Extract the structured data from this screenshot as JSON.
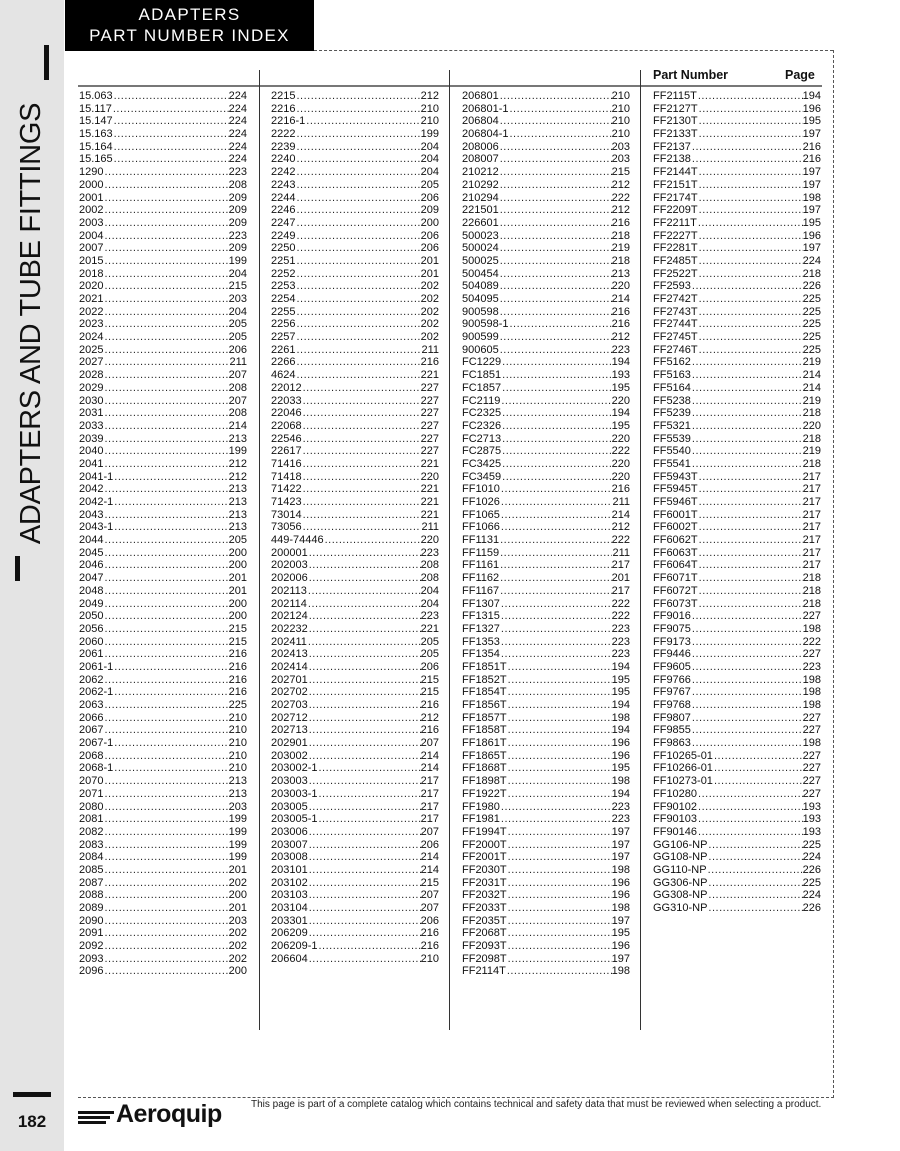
{
  "header": {
    "title_line1": "ADAPTERS",
    "title_line2": "PART NUMBER INDEX"
  },
  "sidebar": {
    "section_label": "ADAPTERS AND TUBE FITTINGS",
    "page_number": "182"
  },
  "table": {
    "header_part_number": "Part Number",
    "header_page": "Page",
    "columns": [
      [
        [
          "15.063",
          "224"
        ],
        [
          "15.117",
          "224"
        ],
        [
          "15.147",
          "224"
        ],
        [
          "15.163",
          "224"
        ],
        [
          "15.164",
          "224"
        ],
        [
          "15.165",
          "224"
        ],
        [
          "1290",
          "223"
        ],
        [
          "2000",
          "208"
        ],
        [
          "2001",
          "209"
        ],
        [
          "2002",
          "209"
        ],
        [
          "2003",
          "209"
        ],
        [
          "2004",
          "223"
        ],
        [
          "2007",
          "209"
        ],
        [
          "2015",
          "199"
        ],
        [
          "2018",
          "204"
        ],
        [
          "2020",
          "215"
        ],
        [
          "2021",
          "203"
        ],
        [
          "2022",
          "204"
        ],
        [
          "2023",
          "205"
        ],
        [
          "2024",
          "205"
        ],
        [
          "2025",
          "206"
        ],
        [
          "2027",
          "211"
        ],
        [
          "2028",
          "207"
        ],
        [
          "2029",
          "208"
        ],
        [
          "2030",
          "207"
        ],
        [
          "2031",
          "208"
        ],
        [
          "2033",
          "214"
        ],
        [
          "2039",
          "213"
        ],
        [
          "2040",
          "199"
        ],
        [
          "2041",
          "212"
        ],
        [
          "2041-1",
          "212"
        ],
        [
          "2042",
          "213"
        ],
        [
          "2042-1",
          "213"
        ],
        [
          "2043",
          "213"
        ],
        [
          "2043-1",
          "213"
        ],
        [
          "2044",
          "205"
        ],
        [
          "2045",
          "200"
        ],
        [
          "2046",
          "200"
        ],
        [
          "2047",
          "201"
        ],
        [
          "2048",
          "201"
        ],
        [
          "2049",
          "200"
        ],
        [
          "2050",
          "200"
        ],
        [
          "2056",
          "215"
        ],
        [
          "2060",
          "215"
        ],
        [
          "2061",
          "216"
        ],
        [
          "2061-1",
          "216"
        ],
        [
          "2062",
          "216"
        ],
        [
          "2062-1",
          "216"
        ],
        [
          "2063",
          "225"
        ],
        [
          "2066",
          "210"
        ],
        [
          "2067",
          "210"
        ],
        [
          "2067-1",
          "210"
        ],
        [
          "2068",
          "210"
        ],
        [
          "2068-1",
          "210"
        ],
        [
          "2070",
          "213"
        ],
        [
          "2071",
          "213"
        ],
        [
          "2080",
          "203"
        ],
        [
          "2081",
          "199"
        ],
        [
          "2082",
          "199"
        ],
        [
          "2083",
          "199"
        ],
        [
          "2084",
          "199"
        ],
        [
          "2085",
          "201"
        ],
        [
          "2087",
          "202"
        ],
        [
          "2088",
          "200"
        ],
        [
          "2089",
          "201"
        ],
        [
          "2090",
          "203"
        ],
        [
          "2091",
          "202"
        ],
        [
          "2092",
          "202"
        ],
        [
          "2093",
          "202"
        ],
        [
          "2096",
          "200"
        ]
      ],
      [
        [
          "2215",
          "212"
        ],
        [
          "2216",
          "210"
        ],
        [
          "2216-1",
          "210"
        ],
        [
          "2222",
          "199"
        ],
        [
          "2239",
          "204"
        ],
        [
          "2240",
          "204"
        ],
        [
          "2242",
          "204"
        ],
        [
          "2243",
          "205"
        ],
        [
          "2244",
          "206"
        ],
        [
          "2246",
          "209"
        ],
        [
          "2247",
          "200"
        ],
        [
          "2249",
          "206"
        ],
        [
          "2250",
          "206"
        ],
        [
          "2251",
          "201"
        ],
        [
          "2252",
          "201"
        ],
        [
          "2253",
          "202"
        ],
        [
          "2254",
          "202"
        ],
        [
          "2255",
          "202"
        ],
        [
          "2256",
          "202"
        ],
        [
          "2257",
          "202"
        ],
        [
          "2261",
          "211"
        ],
        [
          "2266",
          "216"
        ],
        [
          "4624",
          "221"
        ],
        [
          "22012",
          "227"
        ],
        [
          "22033",
          "227"
        ],
        [
          "22046",
          "227"
        ],
        [
          "22068",
          "227"
        ],
        [
          "22546",
          "227"
        ],
        [
          "22617",
          "227"
        ],
        [
          "71416",
          "221"
        ],
        [
          "71418",
          "220"
        ],
        [
          "71422",
          "221"
        ],
        [
          "71423",
          "221"
        ],
        [
          "73014",
          "221"
        ],
        [
          "73056",
          "211"
        ],
        [
          "449-74446",
          "220"
        ],
        [
          "200001",
          "223"
        ],
        [
          "202003",
          "208"
        ],
        [
          "202006",
          "208"
        ],
        [
          "202113",
          "204"
        ],
        [
          "202114",
          "204"
        ],
        [
          "202124",
          "223"
        ],
        [
          "202232",
          "221"
        ],
        [
          "202411",
          "205"
        ],
        [
          "202413",
          "205"
        ],
        [
          "202414",
          "206"
        ],
        [
          "202701",
          "215"
        ],
        [
          "202702",
          "215"
        ],
        [
          "202703",
          "216"
        ],
        [
          "202712",
          "212"
        ],
        [
          "202713",
          "216"
        ],
        [
          "202901",
          "207"
        ],
        [
          "203002",
          "214"
        ],
        [
          "203002-1",
          "214"
        ],
        [
          "203003",
          "217"
        ],
        [
          "203003-1",
          "217"
        ],
        [
          "203005",
          "217"
        ],
        [
          "203005-1",
          "217"
        ],
        [
          "203006",
          "207"
        ],
        [
          "203007",
          "206"
        ],
        [
          "203008",
          "214"
        ],
        [
          "203101",
          "214"
        ],
        [
          "203102",
          "215"
        ],
        [
          "203103",
          "207"
        ],
        [
          "203104",
          "207"
        ],
        [
          "203301",
          "206"
        ],
        [
          "206209",
          "216"
        ],
        [
          "206209-1",
          "216"
        ],
        [
          "206604",
          "210"
        ]
      ],
      [
        [
          "206801",
          "210"
        ],
        [
          "206801-1",
          "210"
        ],
        [
          "206804",
          "210"
        ],
        [
          "206804-1",
          "210"
        ],
        [
          "208006",
          "203"
        ],
        [
          "208007",
          "203"
        ],
        [
          "210212",
          "215"
        ],
        [
          "210292",
          "212"
        ],
        [
          "210294",
          "222"
        ],
        [
          "221501",
          "212"
        ],
        [
          "226601",
          "216"
        ],
        [
          "500023",
          "218"
        ],
        [
          "500024",
          "219"
        ],
        [
          "500025",
          "218"
        ],
        [
          "500454",
          "213"
        ],
        [
          "504089",
          "220"
        ],
        [
          "504095",
          "214"
        ],
        [
          "900598",
          "216"
        ],
        [
          "900598-1",
          "216"
        ],
        [
          "900599",
          "212"
        ],
        [
          "900605",
          "223"
        ],
        [
          "FC1229",
          "194"
        ],
        [
          "FC1851",
          "193"
        ],
        [
          "FC1857",
          "195"
        ],
        [
          "FC2119",
          "220"
        ],
        [
          "FC2325",
          "194"
        ],
        [
          "FC2326",
          "195"
        ],
        [
          "FC2713",
          "220"
        ],
        [
          "FC2875",
          "222"
        ],
        [
          "FC3425",
          "220"
        ],
        [
          "FC3459",
          "220"
        ],
        [
          "FF1010",
          "216"
        ],
        [
          "FF1026",
          "211"
        ],
        [
          "FF1065",
          "214"
        ],
        [
          "FF1066",
          "212"
        ],
        [
          "FF1131",
          "222"
        ],
        [
          "FF1159",
          "211"
        ],
        [
          "FF1161",
          "217"
        ],
        [
          "FF1162",
          "201"
        ],
        [
          "FF1167",
          "217"
        ],
        [
          "FF1307",
          "222"
        ],
        [
          "FF1315",
          "222"
        ],
        [
          "FF1327",
          "223"
        ],
        [
          "FF1353",
          "223"
        ],
        [
          "FF1354",
          "223"
        ],
        [
          "FF1851T",
          "194"
        ],
        [
          "FF1852T",
          "195"
        ],
        [
          "FF1854T",
          "195"
        ],
        [
          "FF1856T",
          "194"
        ],
        [
          "FF1857T",
          "198"
        ],
        [
          "FF1858T",
          "194"
        ],
        [
          "FF1861T",
          "196"
        ],
        [
          "FF1865T",
          "196"
        ],
        [
          "FF1868T",
          "195"
        ],
        [
          "FF1898T",
          "198"
        ],
        [
          "FF1922T",
          "194"
        ],
        [
          "FF1980",
          "223"
        ],
        [
          "FF1981",
          "223"
        ],
        [
          "FF1994T",
          "197"
        ],
        [
          "FF2000T",
          "197"
        ],
        [
          "FF2001T",
          "197"
        ],
        [
          "FF2030T",
          "198"
        ],
        [
          "FF2031T",
          "196"
        ],
        [
          "FF2032T",
          "196"
        ],
        [
          "FF2033T",
          "198"
        ],
        [
          "FF2035T",
          "197"
        ],
        [
          "FF2068T",
          "195"
        ],
        [
          "FF2093T",
          "196"
        ],
        [
          "FF2098T",
          "197"
        ],
        [
          "FF2114T",
          "198"
        ]
      ],
      [
        [
          "FF2115T",
          "194"
        ],
        [
          "FF2127T",
          "196"
        ],
        [
          "FF2130T",
          "195"
        ],
        [
          "FF2133T",
          "197"
        ],
        [
          "FF2137",
          "216"
        ],
        [
          "FF2138",
          "216"
        ],
        [
          "FF2144T",
          "197"
        ],
        [
          "FF2151T",
          "197"
        ],
        [
          "FF2174T",
          "198"
        ],
        [
          "FF2209T",
          "197"
        ],
        [
          "FF2211T",
          "195"
        ],
        [
          "FF2227T",
          "196"
        ],
        [
          "FF2281T",
          "197"
        ],
        [
          "FF2485T",
          "224"
        ],
        [
          "FF2522T",
          "218"
        ],
        [
          "FF2593",
          "226"
        ],
        [
          "FF2742T",
          "225"
        ],
        [
          "FF2743T",
          "225"
        ],
        [
          "FF2744T",
          "225"
        ],
        [
          "FF2745T",
          "225"
        ],
        [
          "FF2746T",
          "225"
        ],
        [
          "FF5162",
          "219"
        ],
        [
          "FF5163",
          "214"
        ],
        [
          "FF5164",
          "214"
        ],
        [
          "FF5238",
          "219"
        ],
        [
          "FF5239",
          "218"
        ],
        [
          "FF5321",
          "220"
        ],
        [
          "FF5539",
          "218"
        ],
        [
          "FF5540",
          "219"
        ],
        [
          "FF5541",
          "218"
        ],
        [
          "FF5943T",
          "217"
        ],
        [
          "FF5945T",
          "217"
        ],
        [
          "FF5946T",
          "217"
        ],
        [
          "FF6001T",
          "217"
        ],
        [
          "FF6002T",
          "217"
        ],
        [
          "FF6062T",
          "217"
        ],
        [
          "FF6063T",
          "217"
        ],
        [
          "FF6064T",
          "217"
        ],
        [
          "FF6071T",
          "218"
        ],
        [
          "FF6072T",
          "218"
        ],
        [
          "FF6073T",
          "218"
        ],
        [
          "FF9016",
          "227"
        ],
        [
          "FF9075",
          "198"
        ],
        [
          "FF9173",
          "222"
        ],
        [
          "FF9446",
          "227"
        ],
        [
          "FF9605",
          "223"
        ],
        [
          "FF9766",
          "198"
        ],
        [
          "FF9767",
          "198"
        ],
        [
          "FF9768",
          "198"
        ],
        [
          "FF9807",
          "227"
        ],
        [
          "FF9855",
          "227"
        ],
        [
          "FF9863",
          "198"
        ],
        [
          "FF10265-01",
          "227"
        ],
        [
          "FF10266-01",
          "227"
        ],
        [
          "FF10273-01",
          "227"
        ],
        [
          "FF10280",
          "227"
        ],
        [
          "FF90102",
          "193"
        ],
        [
          "FF90103",
          "193"
        ],
        [
          "FF90146",
          "193"
        ],
        [
          "GG106-NP",
          "225"
        ],
        [
          "GG108-NP",
          "224"
        ],
        [
          "GG110-NP",
          "226"
        ],
        [
          "GG306-NP",
          "225"
        ],
        [
          "GG308-NP",
          "224"
        ],
        [
          "GG310-NP",
          "226"
        ]
      ]
    ]
  },
  "footer": {
    "brand": "Aeroquip",
    "disclaimer": "This page is part of a complete catalog which contains technical and safety data that must be reviewed when selecting a product."
  }
}
